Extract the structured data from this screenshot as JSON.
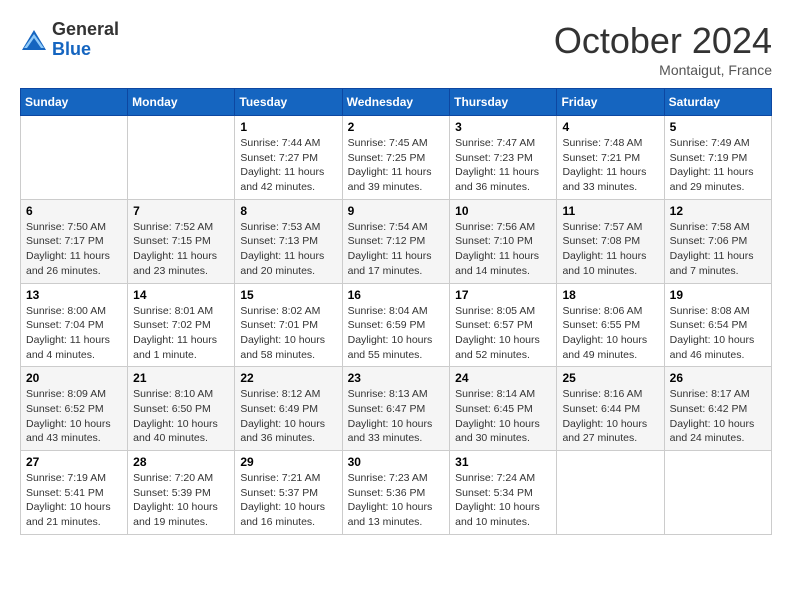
{
  "logo": {
    "general": "General",
    "blue": "Blue"
  },
  "title": "October 2024",
  "location": "Montaigut, France",
  "weekdays": [
    "Sunday",
    "Monday",
    "Tuesday",
    "Wednesday",
    "Thursday",
    "Friday",
    "Saturday"
  ],
  "weeks": [
    [
      {
        "day": "",
        "sunrise": "",
        "sunset": "",
        "daylight": ""
      },
      {
        "day": "",
        "sunrise": "",
        "sunset": "",
        "daylight": ""
      },
      {
        "day": "1",
        "sunrise": "Sunrise: 7:44 AM",
        "sunset": "Sunset: 7:27 PM",
        "daylight": "Daylight: 11 hours and 42 minutes."
      },
      {
        "day": "2",
        "sunrise": "Sunrise: 7:45 AM",
        "sunset": "Sunset: 7:25 PM",
        "daylight": "Daylight: 11 hours and 39 minutes."
      },
      {
        "day": "3",
        "sunrise": "Sunrise: 7:47 AM",
        "sunset": "Sunset: 7:23 PM",
        "daylight": "Daylight: 11 hours and 36 minutes."
      },
      {
        "day": "4",
        "sunrise": "Sunrise: 7:48 AM",
        "sunset": "Sunset: 7:21 PM",
        "daylight": "Daylight: 11 hours and 33 minutes."
      },
      {
        "day": "5",
        "sunrise": "Sunrise: 7:49 AM",
        "sunset": "Sunset: 7:19 PM",
        "daylight": "Daylight: 11 hours and 29 minutes."
      }
    ],
    [
      {
        "day": "6",
        "sunrise": "Sunrise: 7:50 AM",
        "sunset": "Sunset: 7:17 PM",
        "daylight": "Daylight: 11 hours and 26 minutes."
      },
      {
        "day": "7",
        "sunrise": "Sunrise: 7:52 AM",
        "sunset": "Sunset: 7:15 PM",
        "daylight": "Daylight: 11 hours and 23 minutes."
      },
      {
        "day": "8",
        "sunrise": "Sunrise: 7:53 AM",
        "sunset": "Sunset: 7:13 PM",
        "daylight": "Daylight: 11 hours and 20 minutes."
      },
      {
        "day": "9",
        "sunrise": "Sunrise: 7:54 AM",
        "sunset": "Sunset: 7:12 PM",
        "daylight": "Daylight: 11 hours and 17 minutes."
      },
      {
        "day": "10",
        "sunrise": "Sunrise: 7:56 AM",
        "sunset": "Sunset: 7:10 PM",
        "daylight": "Daylight: 11 hours and 14 minutes."
      },
      {
        "day": "11",
        "sunrise": "Sunrise: 7:57 AM",
        "sunset": "Sunset: 7:08 PM",
        "daylight": "Daylight: 11 hours and 10 minutes."
      },
      {
        "day": "12",
        "sunrise": "Sunrise: 7:58 AM",
        "sunset": "Sunset: 7:06 PM",
        "daylight": "Daylight: 11 hours and 7 minutes."
      }
    ],
    [
      {
        "day": "13",
        "sunrise": "Sunrise: 8:00 AM",
        "sunset": "Sunset: 7:04 PM",
        "daylight": "Daylight: 11 hours and 4 minutes."
      },
      {
        "day": "14",
        "sunrise": "Sunrise: 8:01 AM",
        "sunset": "Sunset: 7:02 PM",
        "daylight": "Daylight: 11 hours and 1 minute."
      },
      {
        "day": "15",
        "sunrise": "Sunrise: 8:02 AM",
        "sunset": "Sunset: 7:01 PM",
        "daylight": "Daylight: 10 hours and 58 minutes."
      },
      {
        "day": "16",
        "sunrise": "Sunrise: 8:04 AM",
        "sunset": "Sunset: 6:59 PM",
        "daylight": "Daylight: 10 hours and 55 minutes."
      },
      {
        "day": "17",
        "sunrise": "Sunrise: 8:05 AM",
        "sunset": "Sunset: 6:57 PM",
        "daylight": "Daylight: 10 hours and 52 minutes."
      },
      {
        "day": "18",
        "sunrise": "Sunrise: 8:06 AM",
        "sunset": "Sunset: 6:55 PM",
        "daylight": "Daylight: 10 hours and 49 minutes."
      },
      {
        "day": "19",
        "sunrise": "Sunrise: 8:08 AM",
        "sunset": "Sunset: 6:54 PM",
        "daylight": "Daylight: 10 hours and 46 minutes."
      }
    ],
    [
      {
        "day": "20",
        "sunrise": "Sunrise: 8:09 AM",
        "sunset": "Sunset: 6:52 PM",
        "daylight": "Daylight: 10 hours and 43 minutes."
      },
      {
        "day": "21",
        "sunrise": "Sunrise: 8:10 AM",
        "sunset": "Sunset: 6:50 PM",
        "daylight": "Daylight: 10 hours and 40 minutes."
      },
      {
        "day": "22",
        "sunrise": "Sunrise: 8:12 AM",
        "sunset": "Sunset: 6:49 PM",
        "daylight": "Daylight: 10 hours and 36 minutes."
      },
      {
        "day": "23",
        "sunrise": "Sunrise: 8:13 AM",
        "sunset": "Sunset: 6:47 PM",
        "daylight": "Daylight: 10 hours and 33 minutes."
      },
      {
        "day": "24",
        "sunrise": "Sunrise: 8:14 AM",
        "sunset": "Sunset: 6:45 PM",
        "daylight": "Daylight: 10 hours and 30 minutes."
      },
      {
        "day": "25",
        "sunrise": "Sunrise: 8:16 AM",
        "sunset": "Sunset: 6:44 PM",
        "daylight": "Daylight: 10 hours and 27 minutes."
      },
      {
        "day": "26",
        "sunrise": "Sunrise: 8:17 AM",
        "sunset": "Sunset: 6:42 PM",
        "daylight": "Daylight: 10 hours and 24 minutes."
      }
    ],
    [
      {
        "day": "27",
        "sunrise": "Sunrise: 7:19 AM",
        "sunset": "Sunset: 5:41 PM",
        "daylight": "Daylight: 10 hours and 21 minutes."
      },
      {
        "day": "28",
        "sunrise": "Sunrise: 7:20 AM",
        "sunset": "Sunset: 5:39 PM",
        "daylight": "Daylight: 10 hours and 19 minutes."
      },
      {
        "day": "29",
        "sunrise": "Sunrise: 7:21 AM",
        "sunset": "Sunset: 5:37 PM",
        "daylight": "Daylight: 10 hours and 16 minutes."
      },
      {
        "day": "30",
        "sunrise": "Sunrise: 7:23 AM",
        "sunset": "Sunset: 5:36 PM",
        "daylight": "Daylight: 10 hours and 13 minutes."
      },
      {
        "day": "31",
        "sunrise": "Sunrise: 7:24 AM",
        "sunset": "Sunset: 5:34 PM",
        "daylight": "Daylight: 10 hours and 10 minutes."
      },
      {
        "day": "",
        "sunrise": "",
        "sunset": "",
        "daylight": ""
      },
      {
        "day": "",
        "sunrise": "",
        "sunset": "",
        "daylight": ""
      }
    ]
  ]
}
